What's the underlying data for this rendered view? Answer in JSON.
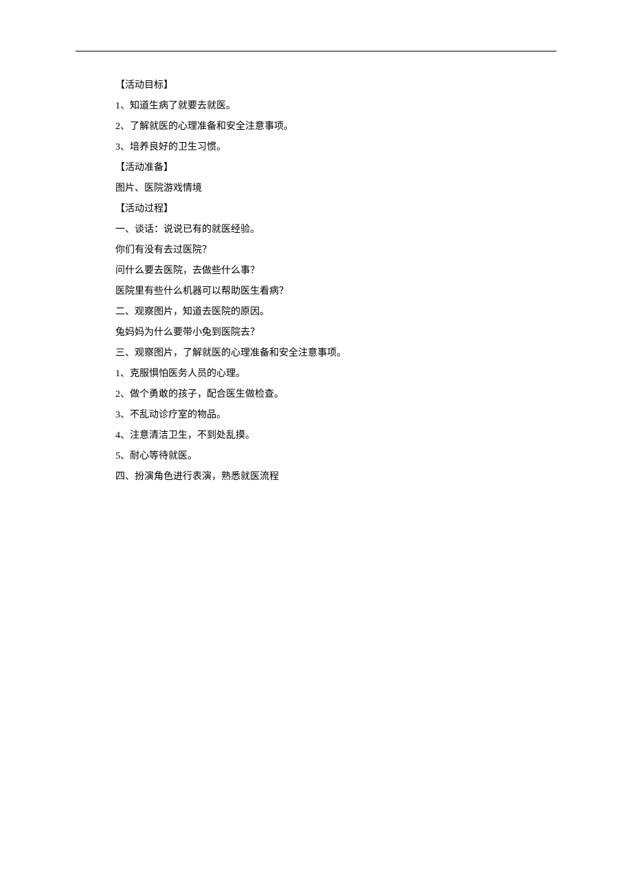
{
  "sections": {
    "goals": {
      "heading": "【活动目标】",
      "items": [
        "1、知道生病了就要去就医。",
        "2、了解就医的心理准备和安全注意事项。",
        "3、培养良好的卫生习惯。"
      ]
    },
    "preparation": {
      "heading": "【活动准备】",
      "items": [
        "图片、医院游戏情境"
      ]
    },
    "process": {
      "heading": "【活动过程】",
      "items": [
        "一、谈话：说说已有的就医经验。",
        "你们有没有去过医院？",
        "问什么要去医院，去做些什么事？",
        "医院里有些什么机器可以帮助医生看病？",
        "二、观察图片，知道去医院的原因。",
        "兔妈妈为什么要带小兔到医院去？",
        "三、观察图片，了解就医的心理准备和安全注意事项。",
        "1、克服惧怕医务人员的心理。",
        "2、做个勇敢的孩子，配合医生做检查。",
        "3、不乱动诊疗室的物品。",
        "4、注意清洁卫生，不到处乱摸。",
        "5、耐心等待就医。",
        "四、扮演角色进行表演，熟悉就医流程"
      ]
    }
  }
}
